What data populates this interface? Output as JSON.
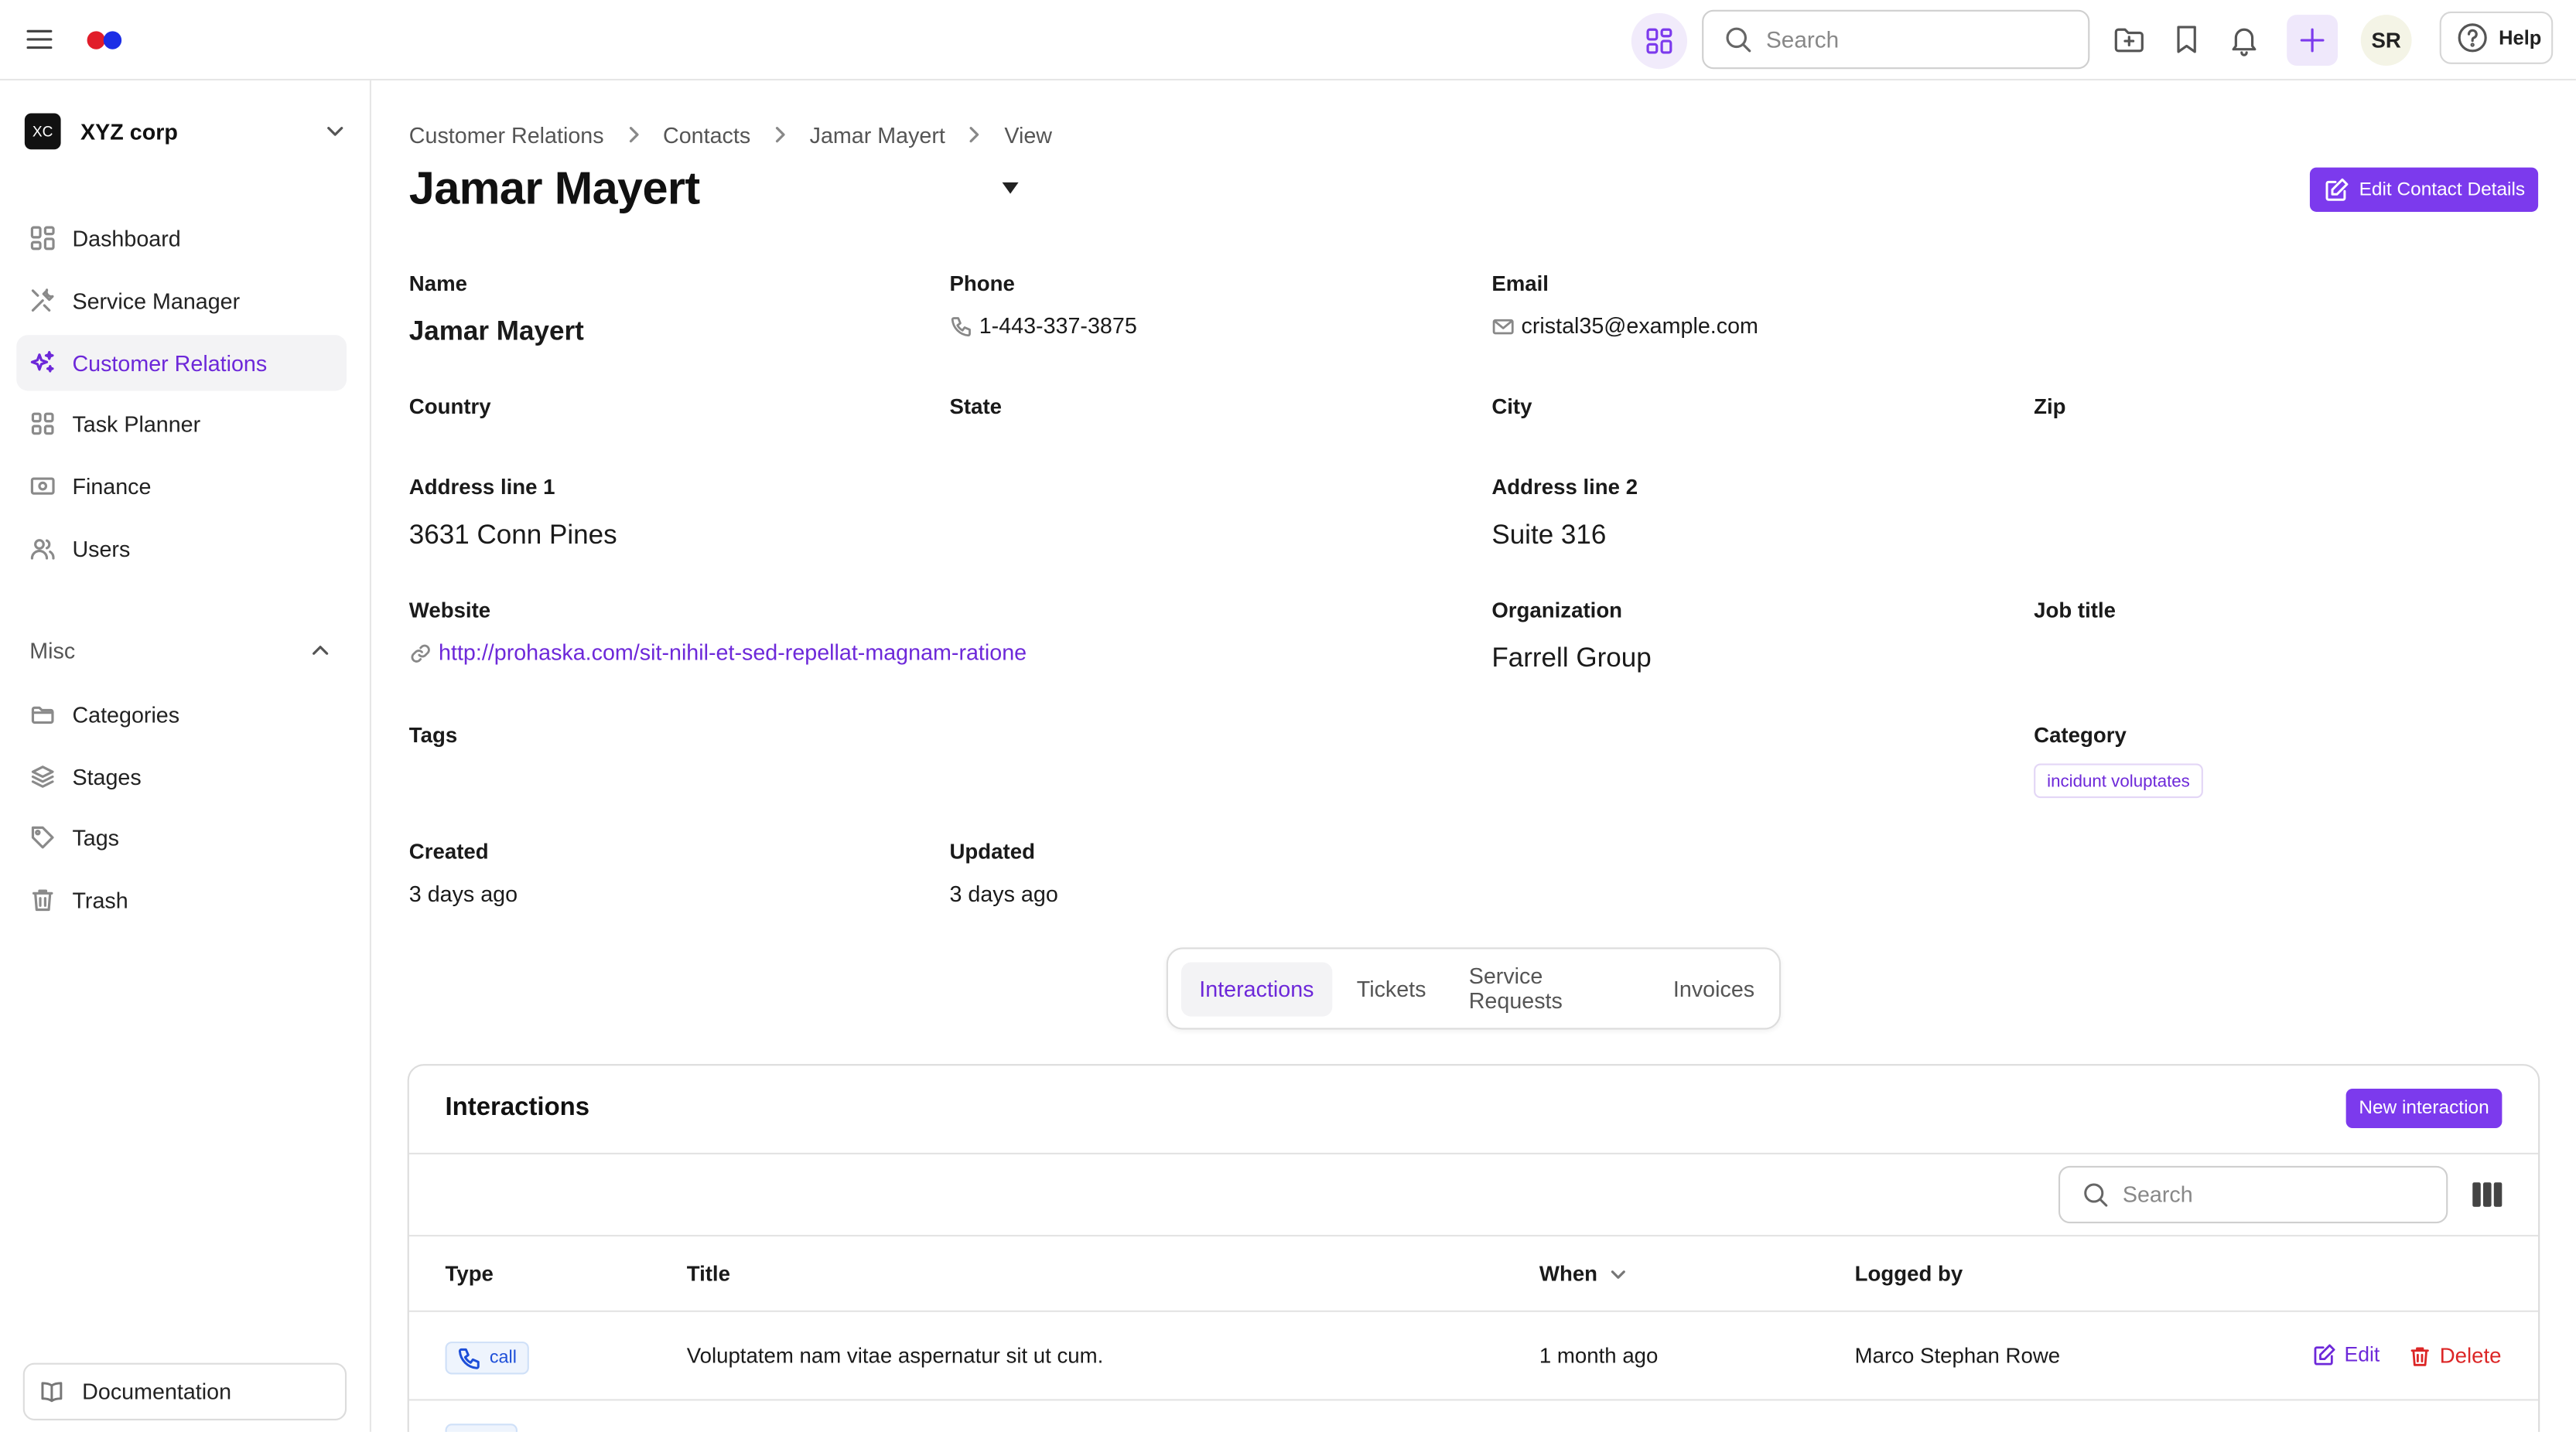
{
  "colors": {
    "accent": "#7c3aed",
    "accent_text": "#6d28d9",
    "danger": "#dc2626",
    "logo_red": "#e11d2a",
    "logo_blue": "#1d2ee6"
  },
  "topbar": {
    "search_placeholder": "Search",
    "avatar_initials": "SR",
    "help_label": "Help",
    "icons": [
      "menu-icon",
      "apps-grid-icon",
      "search-icon",
      "folder-plus-icon",
      "bookmark-icon",
      "bell-icon",
      "plus-icon",
      "help-circle-icon"
    ]
  },
  "sidebar": {
    "org_badge": "XC",
    "org_name": "XYZ corp",
    "items": [
      {
        "label": "Dashboard",
        "icon": "dashboard-icon"
      },
      {
        "label": "Service Manager",
        "icon": "tools-icon"
      },
      {
        "label": "Customer Relations",
        "icon": "sparkles-icon",
        "active": true
      },
      {
        "label": "Task Planner",
        "icon": "grid-icon"
      },
      {
        "label": "Finance",
        "icon": "banknote-icon"
      },
      {
        "label": "Users",
        "icon": "users-icon"
      }
    ],
    "misc_label": "Misc",
    "misc_items": [
      {
        "label": "Categories",
        "icon": "folder-icon"
      },
      {
        "label": "Stages",
        "icon": "layers-icon"
      },
      {
        "label": "Tags",
        "icon": "tag-icon"
      },
      {
        "label": "Trash",
        "icon": "trash-icon"
      }
    ],
    "documentation_label": "Documentation"
  },
  "breadcrumb": [
    "Customer Relations",
    "Contacts",
    "Jamar Mayert",
    "View"
  ],
  "page_title": "Jamar Mayert",
  "edit_contact_label": "Edit Contact Details",
  "fields": {
    "name_label": "Name",
    "name_value": "Jamar Mayert",
    "phone_label": "Phone",
    "phone_value": "1-443-337-3875",
    "email_label": "Email",
    "email_value": "cristal35@example.com",
    "country_label": "Country",
    "state_label": "State",
    "city_label": "City",
    "zip_label": "Zip",
    "address1_label": "Address line 1",
    "address1_value": "3631 Conn Pines",
    "address2_label": "Address line 2",
    "address2_value": "Suite 316",
    "website_label": "Website",
    "website_value": "http://prohaska.com/sit-nihil-et-sed-repellat-magnam-ratione",
    "organization_label": "Organization",
    "organization_value": "Farrell Group",
    "job_title_label": "Job title",
    "tags_label": "Tags",
    "category_label": "Category",
    "category_value": "incidunt voluptates",
    "created_label": "Created",
    "created_value": "3 days ago",
    "updated_label": "Updated",
    "updated_value": "3 days ago"
  },
  "tabs": [
    "Interactions",
    "Tickets",
    "Service Requests",
    "Invoices"
  ],
  "interactions": {
    "title": "Interactions",
    "new_button": "New interaction",
    "search_placeholder": "Search",
    "columns": [
      "Type",
      "Title",
      "When",
      "Logged by"
    ],
    "rows": [
      {
        "type": "call",
        "title": "Voluptatem nam vitae aspernatur sit ut cum.",
        "when": "1 month ago",
        "logged_by": "Marco Stephan Rowe",
        "edit": "Edit",
        "delete": "Delete"
      }
    ]
  }
}
